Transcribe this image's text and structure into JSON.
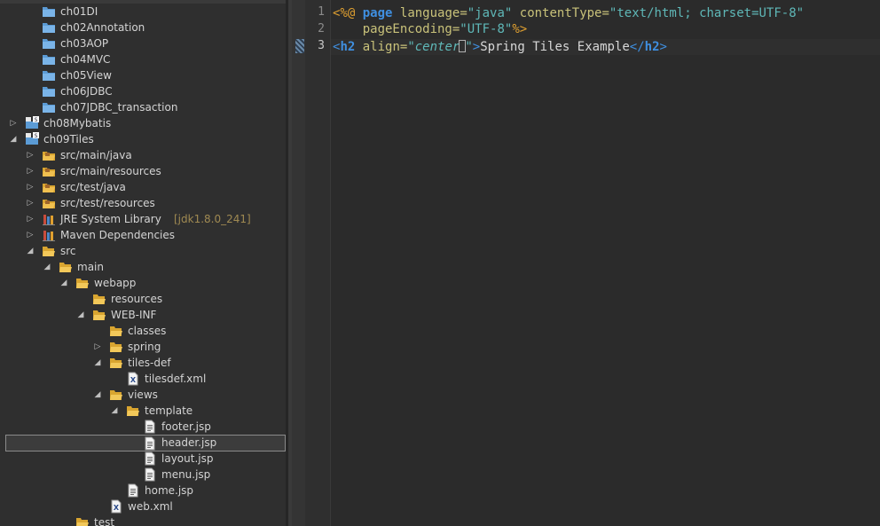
{
  "explorer": {
    "items": [
      {
        "label": "ch01DI",
        "icon": "project-folder-icon",
        "twisty": ""
      },
      {
        "label": "ch02Annotation",
        "icon": "project-folder-icon",
        "twisty": ""
      },
      {
        "label": "ch03AOP",
        "icon": "project-folder-icon",
        "twisty": ""
      },
      {
        "label": "ch04MVC",
        "icon": "project-folder-icon",
        "twisty": ""
      },
      {
        "label": "ch05View",
        "icon": "project-folder-icon",
        "twisty": ""
      },
      {
        "label": "ch06JDBC",
        "icon": "project-folder-icon",
        "twisty": ""
      },
      {
        "label": "ch07JDBC_transaction",
        "icon": "project-folder-icon",
        "twisty": ""
      },
      {
        "label": "ch08Mybatis",
        "icon": "maven-project-icon",
        "twisty": "collapsed"
      },
      {
        "label": "ch09Tiles",
        "icon": "maven-project-icon",
        "twisty": "expanded"
      },
      {
        "label": "src/main/java",
        "icon": "source-folder-icon",
        "twisty": "collapsed"
      },
      {
        "label": "src/main/resources",
        "icon": "source-folder-icon",
        "twisty": "collapsed"
      },
      {
        "label": "src/test/java",
        "icon": "source-folder-icon",
        "twisty": "collapsed"
      },
      {
        "label": "src/test/resources",
        "icon": "source-folder-icon",
        "twisty": "collapsed"
      },
      {
        "label": "JRE System Library",
        "deco": " [jdk1.8.0_241]",
        "icon": "library-icon",
        "twisty": "collapsed"
      },
      {
        "label": "Maven Dependencies",
        "icon": "library-icon",
        "twisty": "collapsed"
      },
      {
        "label": "src",
        "icon": "open-folder-icon",
        "twisty": "expanded"
      },
      {
        "label": "main",
        "icon": "open-folder-icon",
        "twisty": "expanded"
      },
      {
        "label": "webapp",
        "icon": "open-folder-icon",
        "twisty": "expanded"
      },
      {
        "label": "resources",
        "icon": "open-folder-icon",
        "twisty": ""
      },
      {
        "label": "WEB-INF",
        "icon": "open-folder-icon",
        "twisty": "expanded"
      },
      {
        "label": "classes",
        "icon": "open-folder-icon",
        "twisty": ""
      },
      {
        "label": "spring",
        "icon": "open-folder-icon",
        "twisty": "collapsed"
      },
      {
        "label": "tiles-def",
        "icon": "open-folder-icon",
        "twisty": "expanded"
      },
      {
        "label": "tilesdef.xml",
        "icon": "xml-file-icon",
        "twisty": ""
      },
      {
        "label": "views",
        "icon": "open-folder-icon",
        "twisty": "expanded"
      },
      {
        "label": "template",
        "icon": "open-folder-icon",
        "twisty": "expanded"
      },
      {
        "label": "footer.jsp",
        "icon": "jsp-file-icon",
        "twisty": ""
      },
      {
        "label": "header.jsp",
        "icon": "jsp-file-icon",
        "twisty": "",
        "selected": true
      },
      {
        "label": "layout.jsp",
        "icon": "jsp-file-icon",
        "twisty": ""
      },
      {
        "label": "menu.jsp",
        "icon": "jsp-file-icon",
        "twisty": ""
      },
      {
        "label": "home.jsp",
        "icon": "jsp-file-icon",
        "twisty": ""
      },
      {
        "label": "web.xml",
        "icon": "xml-file-icon",
        "twisty": ""
      },
      {
        "label": "test",
        "icon": "open-folder-icon",
        "twisty": ""
      }
    ]
  },
  "editor": {
    "line_numbers": [
      "1",
      "2",
      "3"
    ],
    "line1": {
      "open": "<%@",
      "kw": "page",
      "a1": "language=",
      "v1": "\"java\"",
      "a2": "contentType=",
      "v2": "\"text/html; charset=UTF-8\""
    },
    "line2": {
      "a3": "pageEncoding=",
      "v3": "\"UTF-8\"",
      "close": "%>"
    },
    "line3": {
      "lt": "<",
      "tag": "h2",
      "attr": "align=",
      "val_a": "\"center",
      "val_b": "\"",
      "gt": ">",
      "text": "Spring Tiles Example",
      "lt2": "</",
      "tag2": "h2",
      "gt2": ">"
    }
  }
}
